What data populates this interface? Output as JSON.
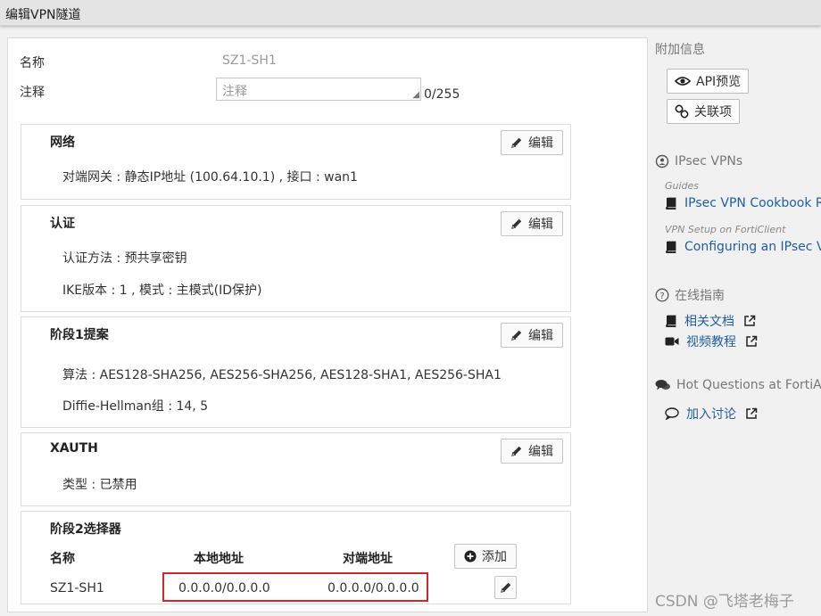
{
  "window": {
    "title": "编辑VPN隧道"
  },
  "form": {
    "name_label": "名称",
    "name_value": "SZ1-SH1",
    "comment_label": "注释",
    "comment_placeholder": "注释",
    "comment_counter": "0/255"
  },
  "sections": {
    "network": {
      "title": "网络",
      "edit_label": "编辑",
      "line1": "对端网关 : 静态IP地址 (100.64.10.1) , 接口 : wan1"
    },
    "auth": {
      "title": "认证",
      "edit_label": "编辑",
      "line1": "认证方法 : 预共享密钥",
      "line2": "IKE版本 : 1 , 模式 : 主模式(ID保护)"
    },
    "phase1": {
      "title": "阶段1提案",
      "edit_label": "编辑",
      "line1": "算法 : AES128-SHA256, AES256-SHA256, AES128-SHA1, AES256-SHA1",
      "line2": "Diffie-Hellman组 : 14, 5"
    },
    "xauth": {
      "title": "XAUTH",
      "edit_label": "编辑",
      "line1": "类型 : 已禁用"
    },
    "phase2": {
      "title": "阶段2选择器",
      "columns": [
        "名称",
        "本地地址",
        "对端地址"
      ],
      "add_label": "添加",
      "rows": [
        {
          "name": "SZ1-SH1",
          "local": "0.0.0.0/0.0.0.0",
          "remote": "0.0.0.0/0.0.0.0"
        }
      ]
    }
  },
  "sidebar": {
    "additional_info": "附加信息",
    "api_preview": "API预览",
    "references": "关联项",
    "ipsec_heading": "IPsec VPNs",
    "guides_label": "Guides",
    "guide_link": "IPsec VPN Cookbook R",
    "forticlient_label": "VPN Setup on FortiClient",
    "forticlient_link": "Configuring an IPsec VI",
    "online_guide": "在线指南",
    "docs_link": "相关文档",
    "video_link": "视频教程",
    "hot_questions": "Hot Questions at FortiAr",
    "join_discussion": "加入讨论"
  },
  "watermark": "CSDN @飞塔老梅子",
  "colors": {
    "highlight_border": "#d0262d",
    "link": "#1f5e9e",
    "title_bar": "#e4e4e4"
  }
}
